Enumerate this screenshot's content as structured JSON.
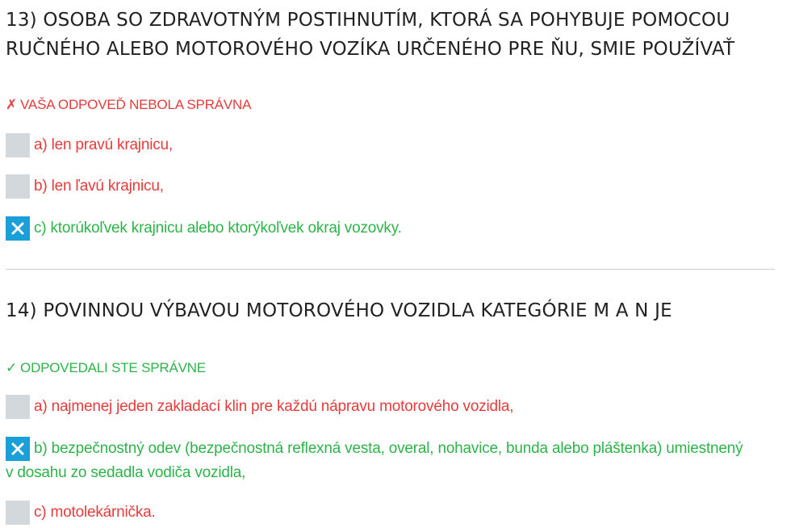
{
  "questions": [
    {
      "title": "13) OSOBA SO ZDRAVOTNÝM POSTIHNUTÍM, KTORÁ SA POHYBUJE POMOCOU RUČNÉHO ALEBO MOTOROVÉHO VOZÍKA URČENÉHO PRE ŇU, SMIE POUŽÍVAŤ",
      "status_mark": "✗",
      "status_text": "VAŠA ODPOVEĎ NEBOLA SPRÁVNA",
      "status_color": "#e63b3b",
      "answers": [
        {
          "text": "a) len pravú krajnicu,",
          "checked": false,
          "color": "#e63b3b"
        },
        {
          "text": "b) len ľavú krajnicu,",
          "checked": false,
          "color": "#e63b3b"
        },
        {
          "text": "c) ktorúkoľvek krajnicu alebo ktorýkoľvek okraj vozovky.",
          "checked": true,
          "color": "#2db34a"
        }
      ]
    },
    {
      "title": "14) POVINNOU VÝBAVOU MOTOROVÉHO VOZIDLA KATEGÓRIE M A N JE",
      "status_mark": "✓",
      "status_text": "ODPOVEDALI STE SPRÁVNE",
      "status_color": "#2db34a",
      "answers": [
        {
          "text": "a) najmenej jeden zakladací klin pre každú nápravu motorového vozidla,",
          "checked": false,
          "color": "#e63b3b"
        },
        {
          "text": "b) bezpečnostný odev (bezpečnostná reflexná vesta, overal, nohavice, bunda alebo pláštenka) umiestnený v dosahu zo sedadla vodiča vozidla,",
          "checked": true,
          "color": "#2db34a"
        },
        {
          "text": "c) motolekárnička.",
          "checked": false,
          "color": "#e63b3b"
        }
      ]
    }
  ],
  "icons": {
    "checked_box": "close-icon",
    "unchecked_box": "empty-checkbox"
  },
  "colors": {
    "checkbox_checked": "#1a9fd8",
    "checkbox_unchecked": "#d3d8dc",
    "title": "#222222",
    "divider": "#cccccc"
  }
}
